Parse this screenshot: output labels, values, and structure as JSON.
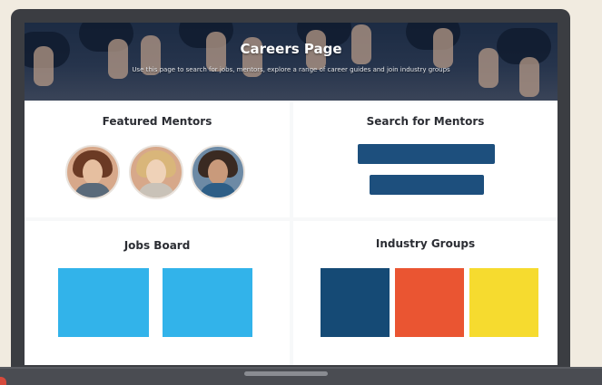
{
  "hero": {
    "title": "Careers Page",
    "subtitle": "Use this page to search for jobs, mentors, explore a range of career guides and join industry groups"
  },
  "featured_mentors": {
    "title": "Featured Mentors",
    "mentors": [
      {
        "name": "mentor-1",
        "hair": "#6b3a24",
        "skin": "#e6bfa0",
        "shirt": "#5a6a7a"
      },
      {
        "name": "mentor-2",
        "hair": "#d9b67a",
        "skin": "#efd2b8",
        "shirt": "#c9c2b8"
      },
      {
        "name": "mentor-3",
        "hair": "#3a2a22",
        "skin": "#c99a7b",
        "shirt": "#2e5e86"
      }
    ]
  },
  "search_mentors": {
    "title": "Search for Mentors"
  },
  "jobs_board": {
    "title": "Jobs Board",
    "tile_color": "#32b3ea"
  },
  "industry_groups": {
    "title": "Industry Groups",
    "tile_colors": [
      "#154a75",
      "#ea5532",
      "#f6db2f"
    ]
  },
  "colors": {
    "search_bar": "#1d4f7d",
    "background": "#f1ebe0",
    "laptop": "#3b3d42"
  }
}
